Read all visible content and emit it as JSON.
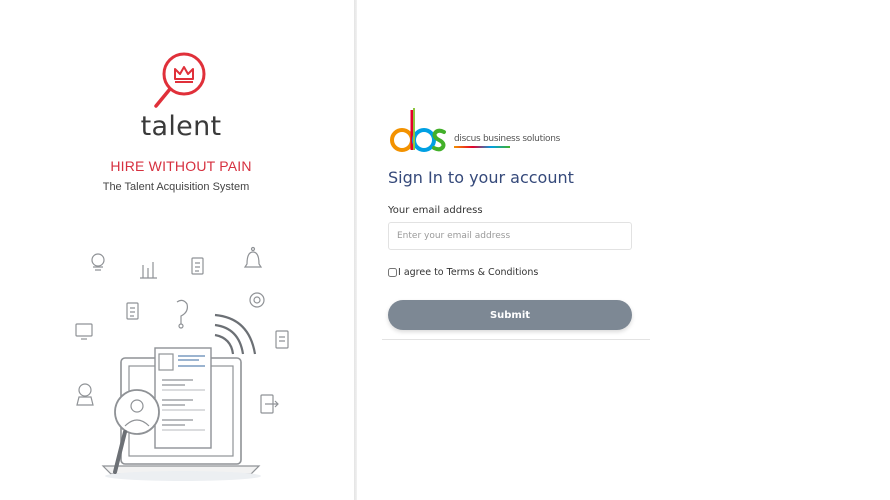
{
  "left": {
    "logo_word": "talent",
    "tagline": "HIRE WITHOUT PAIN",
    "subtitle": "The Talent Acquisition System"
  },
  "brand": {
    "logo_text": "dbs",
    "name": "discus business solutions"
  },
  "signin": {
    "title": "Sign In to your account",
    "email_label": "Your email address",
    "email_placeholder": "Enter your email address",
    "email_value": "",
    "agree_text": "I agree to Terms & Conditions",
    "agree_checked": false,
    "submit_label": "Submit"
  },
  "colors": {
    "tagline_red": "#d6303f",
    "title_blue": "#35497a",
    "button_gray": "#7d8894",
    "logo_red": "#e0303a"
  },
  "icons": [
    "magnifier-crown-icon",
    "resume-laptop-illustration",
    "wifi-signal-icon",
    "bell-icon",
    "gear-icon",
    "document-icon",
    "chart-icon",
    "idea-icon"
  ]
}
